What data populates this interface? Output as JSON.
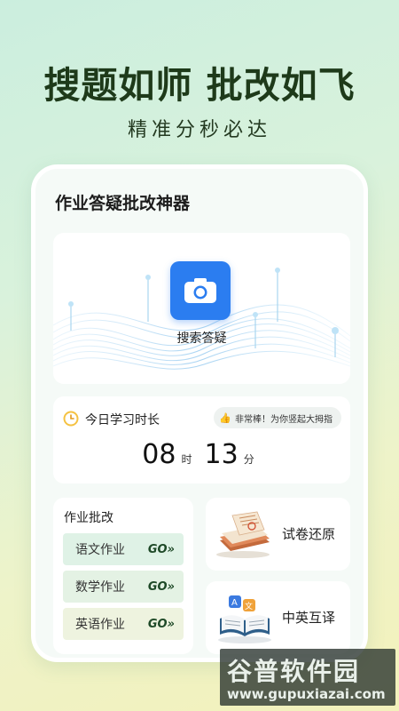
{
  "promo": {
    "headline": "搜题如师 批改如飞",
    "subline": "精准分秒必达"
  },
  "app": {
    "title": "作业答疑批改神器"
  },
  "search": {
    "label": "搜索答疑",
    "icon": "camera-icon",
    "accent": "#2b7df0"
  },
  "study_time": {
    "label": "今日学习时长",
    "praise": "非常棒！为你竖起大拇指",
    "hours": "08",
    "hours_unit": "时",
    "minutes": "13",
    "minutes_unit": "分"
  },
  "homework": {
    "title": "作业批改",
    "items": [
      {
        "label": "语文作业",
        "go": "GO»"
      },
      {
        "label": "数学作业",
        "go": "GO»"
      },
      {
        "label": "英语作业",
        "go": "GO»"
      }
    ]
  },
  "features": [
    {
      "label": "试卷还原",
      "icon": "exam-papers-icon"
    },
    {
      "label": "中英互译",
      "icon": "translate-book-icon"
    }
  ],
  "watermark": {
    "main": "谷普软件园",
    "url": "www.gupuxiazai.com"
  }
}
